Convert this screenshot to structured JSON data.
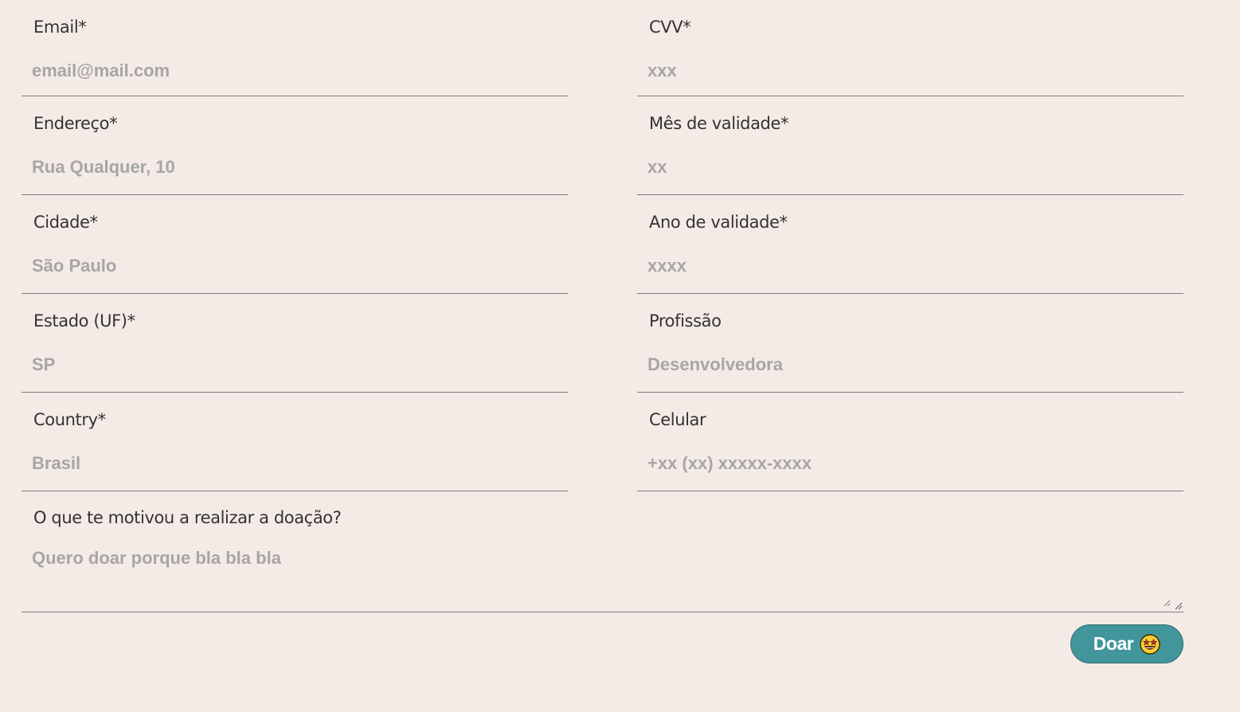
{
  "form": {
    "left_fields": [
      {
        "label": "Email*",
        "placeholder": "email@mail.com"
      },
      {
        "label": "Endereço*",
        "placeholder": "Rua Qualquer, 10"
      },
      {
        "label": "Cidade*",
        "placeholder": "São Paulo"
      },
      {
        "label": "Estado (UF)*",
        "placeholder": "SP"
      },
      {
        "label": "Country*",
        "placeholder": "Brasil"
      }
    ],
    "right_fields": [
      {
        "label": "CVV*",
        "placeholder": "xxx"
      },
      {
        "label": "Mês de validade*",
        "placeholder": "xx"
      },
      {
        "label": "Ano de validade*",
        "placeholder": "xxxx"
      },
      {
        "label": "Profissão",
        "placeholder": "Desenvolvedora"
      },
      {
        "label": "Celular",
        "placeholder": "+xx (xx) xxxxx-xxxx"
      }
    ],
    "motivation": {
      "label": "O que te motivou a realizar a doação?",
      "placeholder": "Quero doar porque bla bla bla"
    },
    "submit": {
      "label": "Doar",
      "icon": "star-struck-emoji-icon"
    }
  },
  "colors": {
    "background": "#f5ebe6",
    "button": "#41969b",
    "placeholder": "#a6a6a6",
    "label": "#333333",
    "underline": "#7d7d7d"
  }
}
